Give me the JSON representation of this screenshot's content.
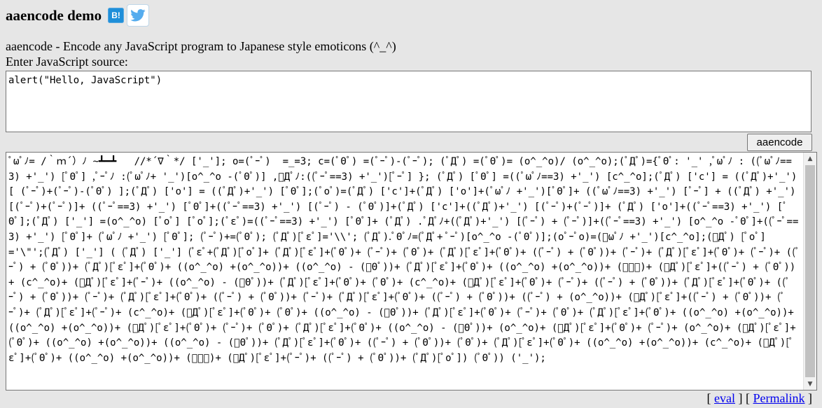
{
  "header": {
    "title": "aaencode demo",
    "hatena_label": "B!",
    "twitter_icon": "twitter-bird-icon"
  },
  "subtitle": "aaencode - Encode any JavaScript program to Japanese style emoticons (^_^)",
  "source": {
    "label": "Enter JavaScript source:",
    "value": "alert(\"Hello, JavaScript\")"
  },
  "encode_button": "aaencode",
  "output": {
    "text": "ﾟωﾟﾉ= /｀ｍ´）ﾉ ~┻━┻   //*´∇｀*/ ['_']; o=(ﾟｰﾟ)  =_=3; c=(ﾟΘﾟ) =(ﾟｰﾟ)-(ﾟｰﾟ); (ﾟДﾟ) =(ﾟΘﾟ)= (o^_^o)/ (o^_^o);(ﾟДﾟ)={ﾟΘﾟ: '_' ,ﾟωﾟﾉ : ((ﾟωﾟﾉ==3) +'_') [ﾟΘﾟ] ,ﾟｰﾟﾉ :(ﾟωﾟﾉ+ '_')[o^_^o -(ﾟΘﾟ)] ,ﾟДﾟﾉ:((ﾟｰﾟ==3) +'_')[ﾟｰﾟ] }; (ﾟДﾟ) [ﾟΘﾟ] =((ﾟωﾟﾉ==3) +'_') [c^_^o];(ﾟДﾟ) ['c'] = ((ﾟДﾟ)+'_') [ (ﾟｰﾟ)+(ﾟｰﾟ)-(ﾟΘﾟ) ];(ﾟДﾟ) ['o'] = ((ﾟДﾟ)+'_') [ﾟΘﾟ];(ﾟoﾟ)=(ﾟДﾟ) ['c']+(ﾟДﾟ) ['o']+(ﾟωﾟﾉ +'_')[ﾟΘﾟ]+ ((ﾟωﾟﾉ==3) +'_') [ﾟｰﾟ] + ((ﾟДﾟ) +'_') [(ﾟｰﾟ)+(ﾟｰﾟ)]+ ((ﾟｰﾟ==3) +'_') [ﾟΘﾟ]+((ﾟｰﾟ==3) +'_') [(ﾟｰﾟ) - (ﾟΘﾟ)]+(ﾟДﾟ) ['c']+((ﾟДﾟ)+'_') [(ﾟｰﾟ)+(ﾟｰﾟ)]+ (ﾟДﾟ) ['o']+((ﾟｰﾟ==3) +'_') [ﾟΘﾟ];(ﾟДﾟ) ['_'] =(o^_^o) [ﾟoﾟ] [ﾟoﾟ];(ﾟεﾟ)=((ﾟｰﾟ==3) +'_') [ﾟΘﾟ]+ (ﾟДﾟ) .ﾟДﾟﾉ+((ﾟДﾟ)+'_') [(ﾟｰﾟ) + (ﾟｰﾟ)]+((ﾟｰﾟ==3) +'_') [o^_^o -ﾟΘﾟ]+((ﾟｰﾟ==3) +'_') [ﾟΘﾟ]+ (ﾟωﾟﾉ +'_') [ﾟΘﾟ]; (ﾟｰﾟ)+=(ﾟΘﾟ); (ﾟДﾟ)[ﾟεﾟ]='\\\\'; (ﾟДﾟ).ﾟΘﾟﾉ=(ﾟДﾟ+ ﾟｰﾟ)[o^_^o -(ﾟΘﾟ)];(oﾟｰﾟo)=(ﾟωﾟﾉ +'_')[c^_^o];(ﾟДﾟ) [ﾟoﾟ]='\\\"';(ﾟДﾟ) ['_'] ( (ﾟДﾟ) ['_'] (ﾟεﾟ+(ﾟДﾟ)[ﾟoﾟ]+ (ﾟДﾟ)[ﾟεﾟ]+(ﾟΘﾟ)+ (ﾟｰﾟ)+ (ﾟΘﾟ)+ (ﾟДﾟ)[ﾟεﾟ]+(ﾟΘﾟ)+ ((ﾟｰﾟ) + (ﾟΘﾟ))+ (ﾟｰﾟ)+ (ﾟДﾟ)[ﾟεﾟ]+(ﾟΘﾟ)+ (ﾟｰﾟ)+ ((ﾟｰﾟ) + (ﾟΘﾟ))+ (ﾟДﾟ)[ﾟεﾟ]+(ﾟΘﾟ)+ ((o^_^o) +(o^_^o))+ ((o^_^o) - (ﾟΘﾟ))+ (ﾟДﾟ)[ﾟεﾟ]+(ﾟΘﾟ)+ ((o^_^o) +(o^_^o))+ (ﾟｰﾟ)+ (ﾟДﾟ)[ﾟεﾟ]+((ﾟｰﾟ) + (ﾟΘﾟ))+ (c^_^o)+ (ﾟДﾟ)[ﾟεﾟ]+(ﾟｰﾟ)+ ((o^_^o) - (ﾟΘﾟ))+ (ﾟДﾟ)[ﾟεﾟ]+(ﾟΘﾟ)+ (ﾟΘﾟ)+ (c^_^o)+ (ﾟДﾟ)[ﾟεﾟ]+(ﾟΘﾟ)+ (ﾟｰﾟ)+ ((ﾟｰﾟ) + (ﾟΘﾟ))+ (ﾟДﾟ)[ﾟεﾟ]+(ﾟΘﾟ)+ ((ﾟｰﾟ) + (ﾟΘﾟ))+ (ﾟｰﾟ)+ (ﾟДﾟ)[ﾟεﾟ]+(ﾟΘﾟ)+ ((ﾟｰﾟ) + (ﾟΘﾟ))+ (ﾟｰﾟ)+ (ﾟДﾟ)[ﾟεﾟ]+(ﾟΘﾟ)+ ((ﾟｰﾟ) + (ﾟΘﾟ))+ ((ﾟｰﾟ) + (o^_^o))+ (ﾟДﾟ)[ﾟεﾟ]+((ﾟｰﾟ) + (ﾟΘﾟ))+ (ﾟｰﾟ)+ (ﾟДﾟ)[ﾟεﾟ]+(ﾟｰﾟ)+ (c^_^o)+ (ﾟДﾟ)[ﾟεﾟ]+(ﾟΘﾟ)+ (ﾟΘﾟ)+ ((o^_^o) - (ﾟΘﾟ))+ (ﾟДﾟ)[ﾟεﾟ]+(ﾟΘﾟ)+ (ﾟｰﾟ)+ (ﾟΘﾟ)+ (ﾟДﾟ)[ﾟεﾟ]+(ﾟΘﾟ)+ ((o^_^o) +(o^_^o))+ ((o^_^o) +(o^_^o))+ (ﾟДﾟ)[ﾟεﾟ]+(ﾟΘﾟ)+ (ﾟｰﾟ)+ (ﾟΘﾟ)+ (ﾟДﾟ)[ﾟεﾟ]+(ﾟΘﾟ)+ ((o^_^o) - (ﾟΘﾟ))+ (o^_^o)+ (ﾟДﾟ)[ﾟεﾟ]+(ﾟΘﾟ)+ (ﾟｰﾟ)+ (o^_^o)+ (ﾟДﾟ)[ﾟεﾟ]+(ﾟΘﾟ)+ ((o^_^o) +(o^_^o))+ ((o^_^o) - (ﾟΘﾟ))+ (ﾟДﾟ)[ﾟεﾟ]+(ﾟΘﾟ)+ ((ﾟｰﾟ) + (ﾟΘﾟ))+ (ﾟΘﾟ)+ (ﾟДﾟ)[ﾟεﾟ]+(ﾟΘﾟ)+ ((o^_^o) +(o^_^o))+ (c^_^o)+ (ﾟДﾟ)[ﾟεﾟ]+(ﾟΘﾟ)+ ((o^_^o) +(o^_^o))+ (ﾟｰﾟ)+ (ﾟДﾟ)[ﾟεﾟ]+(ﾟｰﾟ)+ ((ﾟｰﾟ) + (ﾟΘﾟ))+ (ﾟДﾟ)[ﾟoﾟ]) (ﾟΘﾟ)) ('_');"
  },
  "footer": {
    "open_bracket": "[ ",
    "eval_label": "eval",
    "separator": " ] [ ",
    "permalink_label": "Permalink",
    "close_bracket": " ]"
  }
}
